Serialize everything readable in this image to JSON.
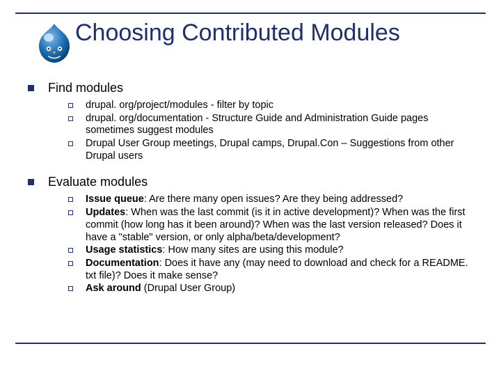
{
  "title": "Choosing Contributed Modules",
  "sections": [
    {
      "heading": "Find modules",
      "items": [
        {
          "html": "drupal. org/project/modules - filter by topic"
        },
        {
          "html": "drupal. org/documentation - Structure Guide and Administration Guide pages sometimes suggest modules"
        },
        {
          "html": "Drupal User Group meetings, Drupal camps, Drupal.Con – Suggestions from other Drupal users"
        }
      ]
    },
    {
      "heading": "Evaluate modules",
      "items": [
        {
          "html": "<b>Issue queue</b>: Are there many open issues? Are they being addressed?"
        },
        {
          "html": "<b>Updates</b>: When was the last commit (is it in active development)? When was the first commit (how long has it been around)? When was the last version released? Does it have a \"stable\" version, or only alpha/beta/development?"
        },
        {
          "html": "<b>Usage statistics</b>: How many sites are using this module?"
        },
        {
          "html": "<b>Documentation</b>: Does it have any (may need to download and check for a README. txt file)? Does it make sense?"
        },
        {
          "html": "<b>Ask around</b> (Drupal User Group)"
        }
      ]
    }
  ]
}
